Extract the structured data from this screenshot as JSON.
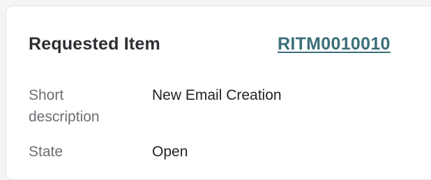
{
  "card": {
    "title": "Requested Item",
    "record_number": "RITM0010010"
  },
  "fields": {
    "short_description": {
      "label_line1": "Short",
      "label_line2": "description",
      "value": "New Email Creation"
    },
    "state": {
      "label": "State",
      "value": "Open"
    }
  }
}
